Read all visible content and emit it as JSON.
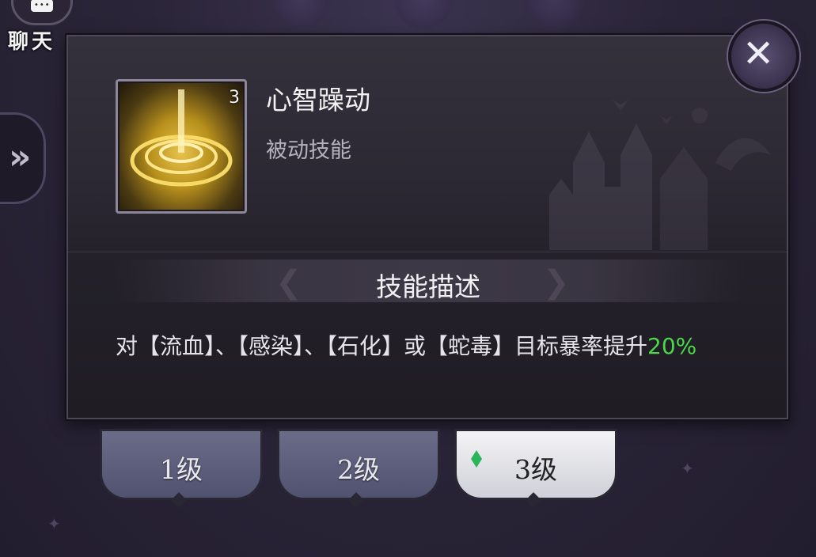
{
  "chat": {
    "label": "聊天"
  },
  "skill": {
    "name": "心智躁动",
    "type": "被动技能",
    "level_badge": "3"
  },
  "description": {
    "header": "技能描述",
    "text_prefix": "对【流血】、【感染】、【石化】或【蛇毒】目标暴率提升",
    "text_highlight": "20%"
  },
  "levels": [
    {
      "label": "1级",
      "active": false
    },
    {
      "label": "2级",
      "active": false
    },
    {
      "label": "3级",
      "active": true
    }
  ],
  "icons": {
    "close": "close-icon",
    "side_expand": "chevron-right-icon",
    "chat": "chat-bubble-icon",
    "level_gem": "gem-icon"
  },
  "colors": {
    "highlight": "#4bd84a",
    "active_tab": "#f4f4f6",
    "inactive_tab": "#5c5e7c"
  }
}
